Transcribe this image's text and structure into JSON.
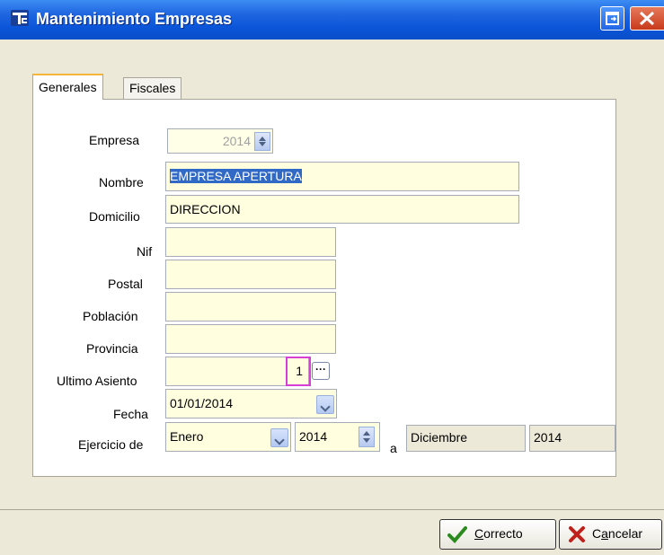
{
  "window": {
    "title": "Mantenimiento Empresas"
  },
  "tabs": [
    {
      "label": "Generales"
    },
    {
      "label": "Fiscales"
    }
  ],
  "form": {
    "empresa": {
      "label": "Empresa",
      "value": "2014"
    },
    "nombre": {
      "label": "Nombre",
      "value": "EMPRESA APERTURA"
    },
    "domicilio": {
      "label": "Domicilio",
      "value": "DIRECCION"
    },
    "nif": {
      "label": "Nif",
      "value": ""
    },
    "postal": {
      "label": "Postal",
      "value": ""
    },
    "poblacion": {
      "label": "Población",
      "value": ""
    },
    "provincia": {
      "label": "Provincia",
      "value": ""
    },
    "ultimo_asiento": {
      "label": "Ultimo Asiento",
      "value": "1",
      "button": "···"
    },
    "fecha": {
      "label": "Fecha",
      "value": "01/01/2014"
    },
    "ejercicio": {
      "label": "Ejercicio de",
      "mes_desde": "Enero",
      "anio_desde": "2014",
      "separator": "a",
      "mes_hasta": "Diciembre",
      "anio_hasta": "2014"
    }
  },
  "buttons": {
    "ok_prefix": "C",
    "ok_rest": "orrecto",
    "cancel_prefix": "C",
    "cancel_underline": "a",
    "cancel_rest": "ncelar"
  },
  "colors": {
    "titlebar": "#0b55d9",
    "field_bg": "#ffffe0",
    "highlight": "#d63fd6",
    "selection": "#3169c6"
  },
  "icons": {
    "app": "tc-logo-icon",
    "restore": "restore-icon",
    "close": "close-icon",
    "ok": "check-icon",
    "cancel": "x-icon"
  }
}
